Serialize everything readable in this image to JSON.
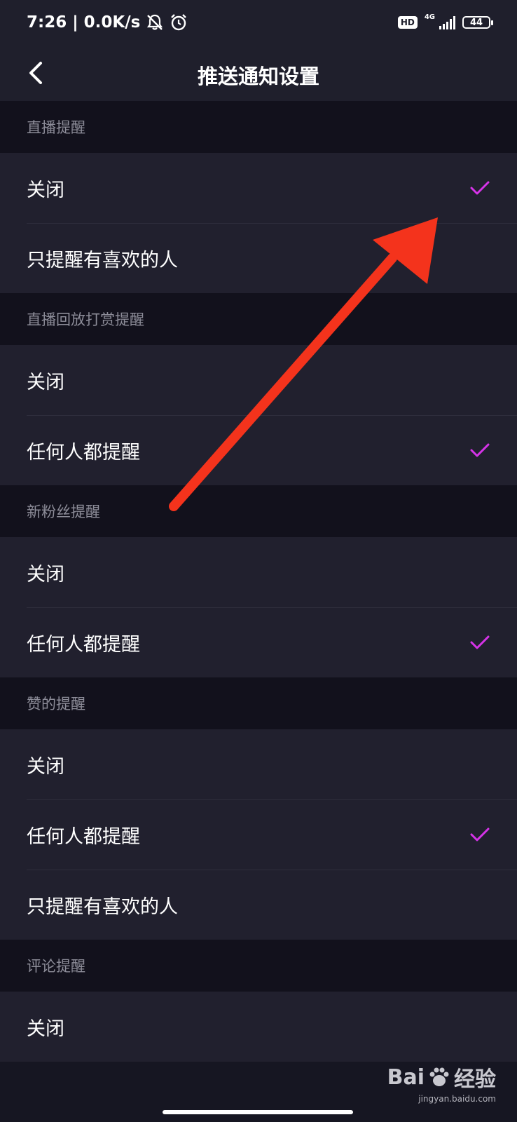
{
  "status_bar": {
    "time": "7:26",
    "separator": "|",
    "speed": "0.0K/s",
    "hd": "HD",
    "network": "4G",
    "battery": "44"
  },
  "nav": {
    "title": "推送通知设置"
  },
  "sections": [
    {
      "header": "直播提醒",
      "options": [
        {
          "label": "关闭",
          "selected": true
        },
        {
          "label": "只提醒有喜欢的人",
          "selected": false
        }
      ]
    },
    {
      "header": "直播回放打赏提醒",
      "options": [
        {
          "label": "关闭",
          "selected": false
        },
        {
          "label": "任何人都提醒",
          "selected": true
        }
      ]
    },
    {
      "header": "新粉丝提醒",
      "options": [
        {
          "label": "关闭",
          "selected": false
        },
        {
          "label": "任何人都提醒",
          "selected": true
        }
      ]
    },
    {
      "header": "赞的提醒",
      "options": [
        {
          "label": "关闭",
          "selected": false
        },
        {
          "label": "任何人都提醒",
          "selected": true
        },
        {
          "label": "只提醒有喜欢的人",
          "selected": false
        }
      ]
    },
    {
      "header": "评论提醒",
      "options": [
        {
          "label": "关闭",
          "selected": false
        }
      ]
    }
  ],
  "colors": {
    "check": "#d633e8",
    "annotation_arrow": "#f4331c"
  },
  "watermark": {
    "brand": "Bai",
    "brand_suffix": "经验",
    "url": "jingyan.baidu.com"
  }
}
